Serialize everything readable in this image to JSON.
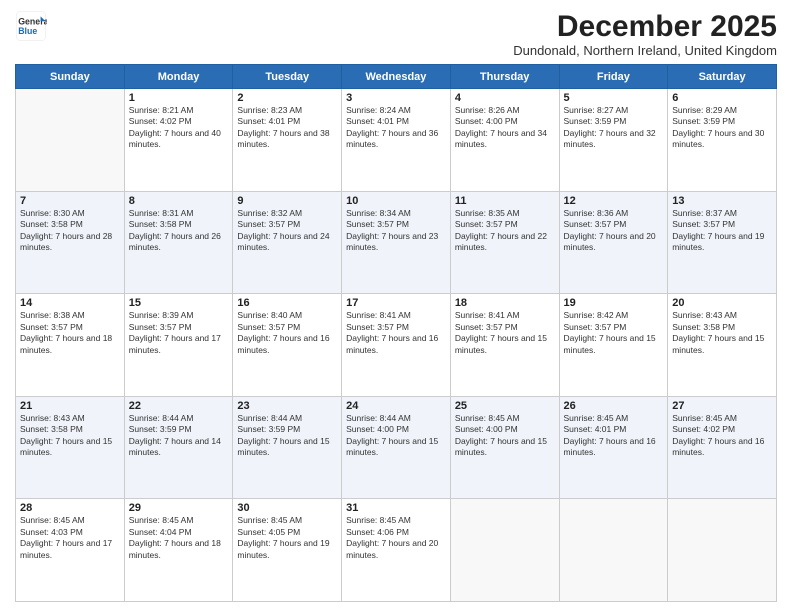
{
  "header": {
    "logo_line1": "General",
    "logo_line2": "Blue",
    "month_title": "December 2025",
    "subtitle": "Dundonald, Northern Ireland, United Kingdom"
  },
  "weekdays": [
    "Sunday",
    "Monday",
    "Tuesday",
    "Wednesday",
    "Thursday",
    "Friday",
    "Saturday"
  ],
  "weeks": [
    [
      {
        "day": "",
        "empty": true
      },
      {
        "day": "1",
        "sunrise": "8:21 AM",
        "sunset": "4:02 PM",
        "daylight": "7 hours and 40 minutes."
      },
      {
        "day": "2",
        "sunrise": "8:23 AM",
        "sunset": "4:01 PM",
        "daylight": "7 hours and 38 minutes."
      },
      {
        "day": "3",
        "sunrise": "8:24 AM",
        "sunset": "4:01 PM",
        "daylight": "7 hours and 36 minutes."
      },
      {
        "day": "4",
        "sunrise": "8:26 AM",
        "sunset": "4:00 PM",
        "daylight": "7 hours and 34 minutes."
      },
      {
        "day": "5",
        "sunrise": "8:27 AM",
        "sunset": "3:59 PM",
        "daylight": "7 hours and 32 minutes."
      },
      {
        "day": "6",
        "sunrise": "8:29 AM",
        "sunset": "3:59 PM",
        "daylight": "7 hours and 30 minutes."
      }
    ],
    [
      {
        "day": "7",
        "sunrise": "8:30 AM",
        "sunset": "3:58 PM",
        "daylight": "7 hours and 28 minutes."
      },
      {
        "day": "8",
        "sunrise": "8:31 AM",
        "sunset": "3:58 PM",
        "daylight": "7 hours and 26 minutes."
      },
      {
        "day": "9",
        "sunrise": "8:32 AM",
        "sunset": "3:57 PM",
        "daylight": "7 hours and 24 minutes."
      },
      {
        "day": "10",
        "sunrise": "8:34 AM",
        "sunset": "3:57 PM",
        "daylight": "7 hours and 23 minutes."
      },
      {
        "day": "11",
        "sunrise": "8:35 AM",
        "sunset": "3:57 PM",
        "daylight": "7 hours and 22 minutes."
      },
      {
        "day": "12",
        "sunrise": "8:36 AM",
        "sunset": "3:57 PM",
        "daylight": "7 hours and 20 minutes."
      },
      {
        "day": "13",
        "sunrise": "8:37 AM",
        "sunset": "3:57 PM",
        "daylight": "7 hours and 19 minutes."
      }
    ],
    [
      {
        "day": "14",
        "sunrise": "8:38 AM",
        "sunset": "3:57 PM",
        "daylight": "7 hours and 18 minutes."
      },
      {
        "day": "15",
        "sunrise": "8:39 AM",
        "sunset": "3:57 PM",
        "daylight": "7 hours and 17 minutes."
      },
      {
        "day": "16",
        "sunrise": "8:40 AM",
        "sunset": "3:57 PM",
        "daylight": "7 hours and 16 minutes."
      },
      {
        "day": "17",
        "sunrise": "8:41 AM",
        "sunset": "3:57 PM",
        "daylight": "7 hours and 16 minutes."
      },
      {
        "day": "18",
        "sunrise": "8:41 AM",
        "sunset": "3:57 PM",
        "daylight": "7 hours and 15 minutes."
      },
      {
        "day": "19",
        "sunrise": "8:42 AM",
        "sunset": "3:57 PM",
        "daylight": "7 hours and 15 minutes."
      },
      {
        "day": "20",
        "sunrise": "8:43 AM",
        "sunset": "3:58 PM",
        "daylight": "7 hours and 15 minutes."
      }
    ],
    [
      {
        "day": "21",
        "sunrise": "8:43 AM",
        "sunset": "3:58 PM",
        "daylight": "7 hours and 15 minutes."
      },
      {
        "day": "22",
        "sunrise": "8:44 AM",
        "sunset": "3:59 PM",
        "daylight": "7 hours and 14 minutes."
      },
      {
        "day": "23",
        "sunrise": "8:44 AM",
        "sunset": "3:59 PM",
        "daylight": "7 hours and 15 minutes."
      },
      {
        "day": "24",
        "sunrise": "8:44 AM",
        "sunset": "4:00 PM",
        "daylight": "7 hours and 15 minutes."
      },
      {
        "day": "25",
        "sunrise": "8:45 AM",
        "sunset": "4:00 PM",
        "daylight": "7 hours and 15 minutes."
      },
      {
        "day": "26",
        "sunrise": "8:45 AM",
        "sunset": "4:01 PM",
        "daylight": "7 hours and 16 minutes."
      },
      {
        "day": "27",
        "sunrise": "8:45 AM",
        "sunset": "4:02 PM",
        "daylight": "7 hours and 16 minutes."
      }
    ],
    [
      {
        "day": "28",
        "sunrise": "8:45 AM",
        "sunset": "4:03 PM",
        "daylight": "7 hours and 17 minutes."
      },
      {
        "day": "29",
        "sunrise": "8:45 AM",
        "sunset": "4:04 PM",
        "daylight": "7 hours and 18 minutes."
      },
      {
        "day": "30",
        "sunrise": "8:45 AM",
        "sunset": "4:05 PM",
        "daylight": "7 hours and 19 minutes."
      },
      {
        "day": "31",
        "sunrise": "8:45 AM",
        "sunset": "4:06 PM",
        "daylight": "7 hours and 20 minutes."
      },
      {
        "day": "",
        "empty": true
      },
      {
        "day": "",
        "empty": true
      },
      {
        "day": "",
        "empty": true
      }
    ]
  ]
}
